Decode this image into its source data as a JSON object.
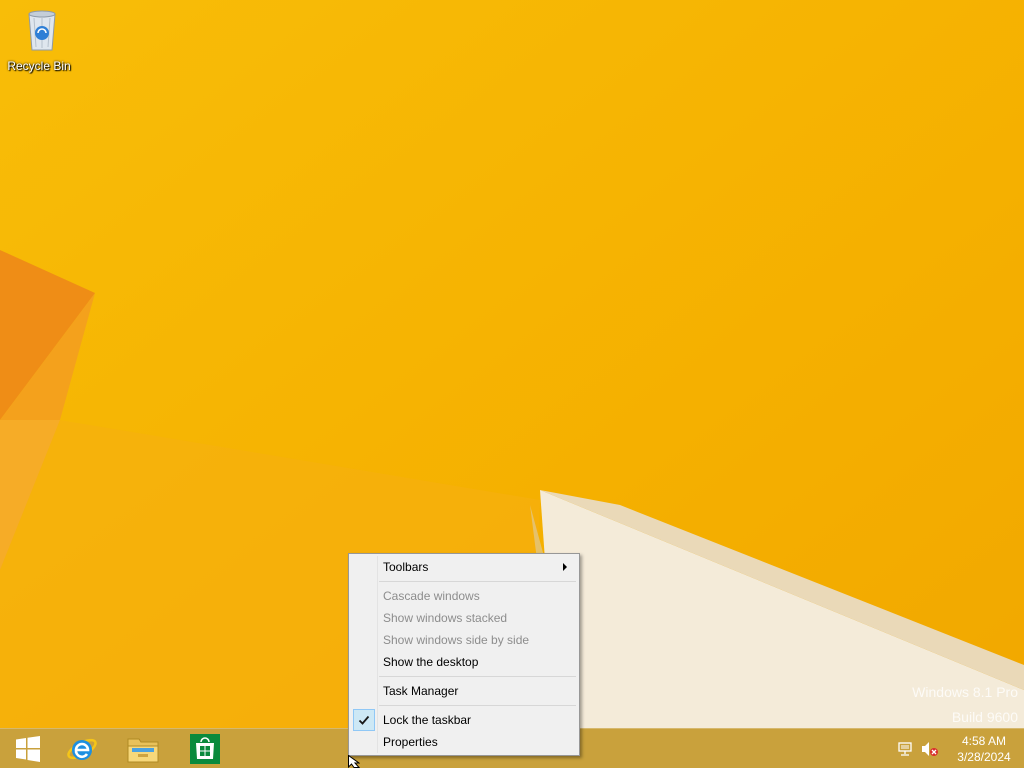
{
  "desktop": {
    "icons": [
      {
        "label": "Recycle Bin",
        "icon": "recycle-bin-icon"
      }
    ],
    "background_color": "#f5b400"
  },
  "watermark": {
    "line1": "Windows 8.1 Pro",
    "line2": "Build 9600"
  },
  "context_menu": {
    "items": [
      {
        "label": "Toolbars",
        "enabled": true,
        "submenu": true
      },
      {
        "label": "Cascade windows",
        "enabled": false
      },
      {
        "label": "Show windows stacked",
        "enabled": false
      },
      {
        "label": "Show windows side by side",
        "enabled": false
      },
      {
        "label": "Show the desktop",
        "enabled": true
      },
      {
        "label": "Task Manager",
        "enabled": true
      },
      {
        "label": "Lock the taskbar",
        "enabled": true,
        "checked": true
      },
      {
        "label": "Properties",
        "enabled": true
      }
    ]
  },
  "taskbar": {
    "pinned": [
      {
        "name": "Start",
        "icon": "windows-logo-icon"
      },
      {
        "name": "Internet Explorer",
        "icon": "internet-explorer-icon"
      },
      {
        "name": "File Explorer",
        "icon": "file-explorer-icon"
      },
      {
        "name": "Store",
        "icon": "store-icon"
      }
    ],
    "tray": {
      "network_icon": "network-icon",
      "volume_icon": "volume-muted-icon"
    },
    "clock": {
      "time": "4:58 AM",
      "date": "3/28/2024"
    },
    "color": "#c9a13c"
  }
}
